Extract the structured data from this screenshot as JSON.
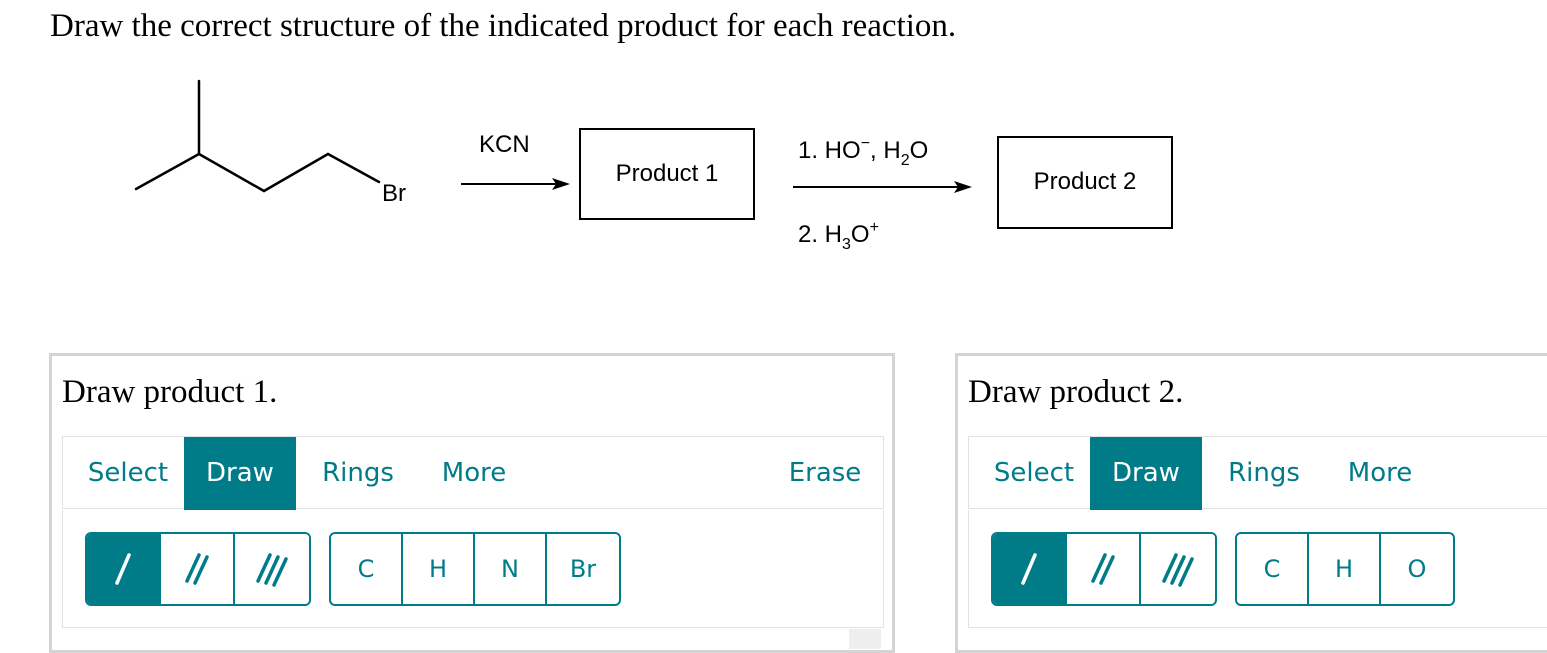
{
  "question": "Draw the correct structure of the indicated product for each reaction.",
  "scheme": {
    "bromine_label": "Br",
    "reagent_1": "KCN",
    "product_1_box": "Product 1",
    "step_1": "1. HO",
    "step_1_charge": "−",
    "step_1_water": ", H",
    "step_1_water_sub": "2",
    "step_1_water_o": "O",
    "step_2": "2. H",
    "step_2_sub": "3",
    "step_2_o": "O",
    "step_2_charge": "+",
    "product_2_box": "Product 2"
  },
  "panels": [
    {
      "title": "Draw product 1.",
      "tabs": {
        "select": "Select",
        "draw": "Draw",
        "rings": "Rings",
        "more": "More",
        "erase": "Erase"
      },
      "atoms": [
        "C",
        "H",
        "N",
        "Br"
      ]
    },
    {
      "title": "Draw product 2.",
      "tabs": {
        "select": "Select",
        "draw": "Draw",
        "rings": "Rings",
        "more": "More"
      },
      "atoms": [
        "C",
        "H",
        "O"
      ]
    }
  ],
  "active_tab": "Draw",
  "active_bond": "single-bond",
  "colors": {
    "accent": "#007c89",
    "panel_border": "#d4d4d4"
  }
}
